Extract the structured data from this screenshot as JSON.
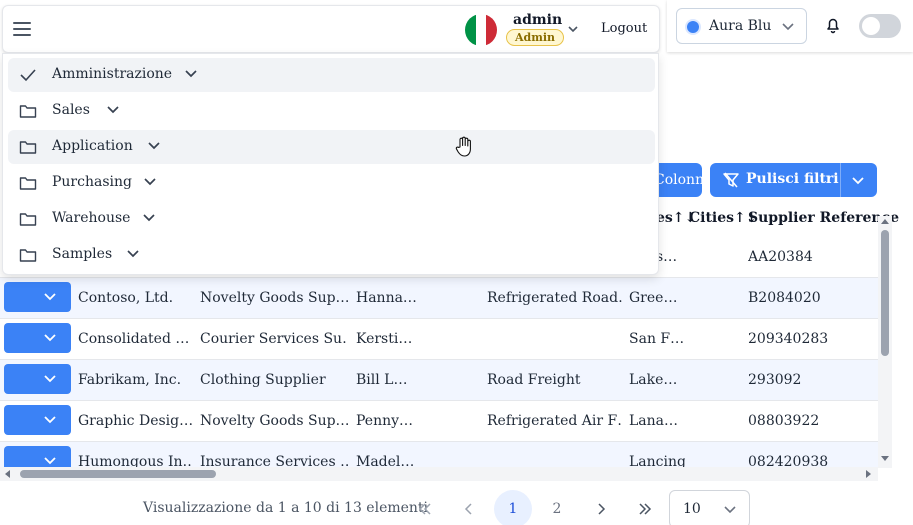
{
  "header": {
    "user": {
      "name": "admin",
      "role": "Admin"
    },
    "logout_label": "Logout",
    "theme": {
      "label": "Aura Blu",
      "accent": "#3b82f6"
    }
  },
  "menu": {
    "items": [
      {
        "label": "Amministrazione",
        "icon": "check-icon"
      },
      {
        "label": "Sales",
        "icon": "folder-icon"
      },
      {
        "label": "Application",
        "icon": "folder-icon"
      },
      {
        "label": "Purchasing",
        "icon": "folder-icon"
      },
      {
        "label": "Warehouse",
        "icon": "folder-icon"
      },
      {
        "label": "Samples",
        "icon": "folder-icon"
      }
    ]
  },
  "actions": {
    "columns_label": "Colonne",
    "clear_filters_label": "Pulisci filtri"
  },
  "table": {
    "headers": {
      "partial": "es↑↓",
      "cities": "Cities↑↓",
      "supplier_reference": "Supplier Reference"
    },
    "rows": [
      {
        "c1": "",
        "c2": "",
        "c3": "",
        "c4": "",
        "c5": "s…",
        "ref": "AA20384"
      },
      {
        "c1": "Contoso, Ltd.",
        "c2": "Novelty Goods Sup…",
        "c3": "Hanna…",
        "c4": "Refrigerated Road…",
        "c5": "Gree…",
        "ref": "B2084020"
      },
      {
        "c1": "Consolidated …",
        "c2": "Courier Services Su…",
        "c3": "Kersti…",
        "c4": "",
        "c5": "San F…",
        "ref": "209340283"
      },
      {
        "c1": "Fabrikam, Inc.",
        "c2": "Clothing Supplier",
        "c3": "Bill L…",
        "c4": "Road Freight",
        "c5": "Lake…",
        "ref": "293092"
      },
      {
        "c1": "Graphic Desig…",
        "c2": "Novelty Goods Sup…",
        "c3": "Penny…",
        "c4": "Refrigerated Air F…",
        "c5": "Lana…",
        "ref": "08803922"
      },
      {
        "c1": "Humongous In…",
        "c2": "Insurance Services …",
        "c3": "Madel…",
        "c4": "",
        "c5": "Lancing",
        "ref": "082420938"
      }
    ]
  },
  "pagination": {
    "info": "Visualizzazione da 1 a 10 di 13 elementi",
    "pages": [
      "1",
      "2"
    ],
    "current": "1",
    "rows_per_page": "10"
  }
}
